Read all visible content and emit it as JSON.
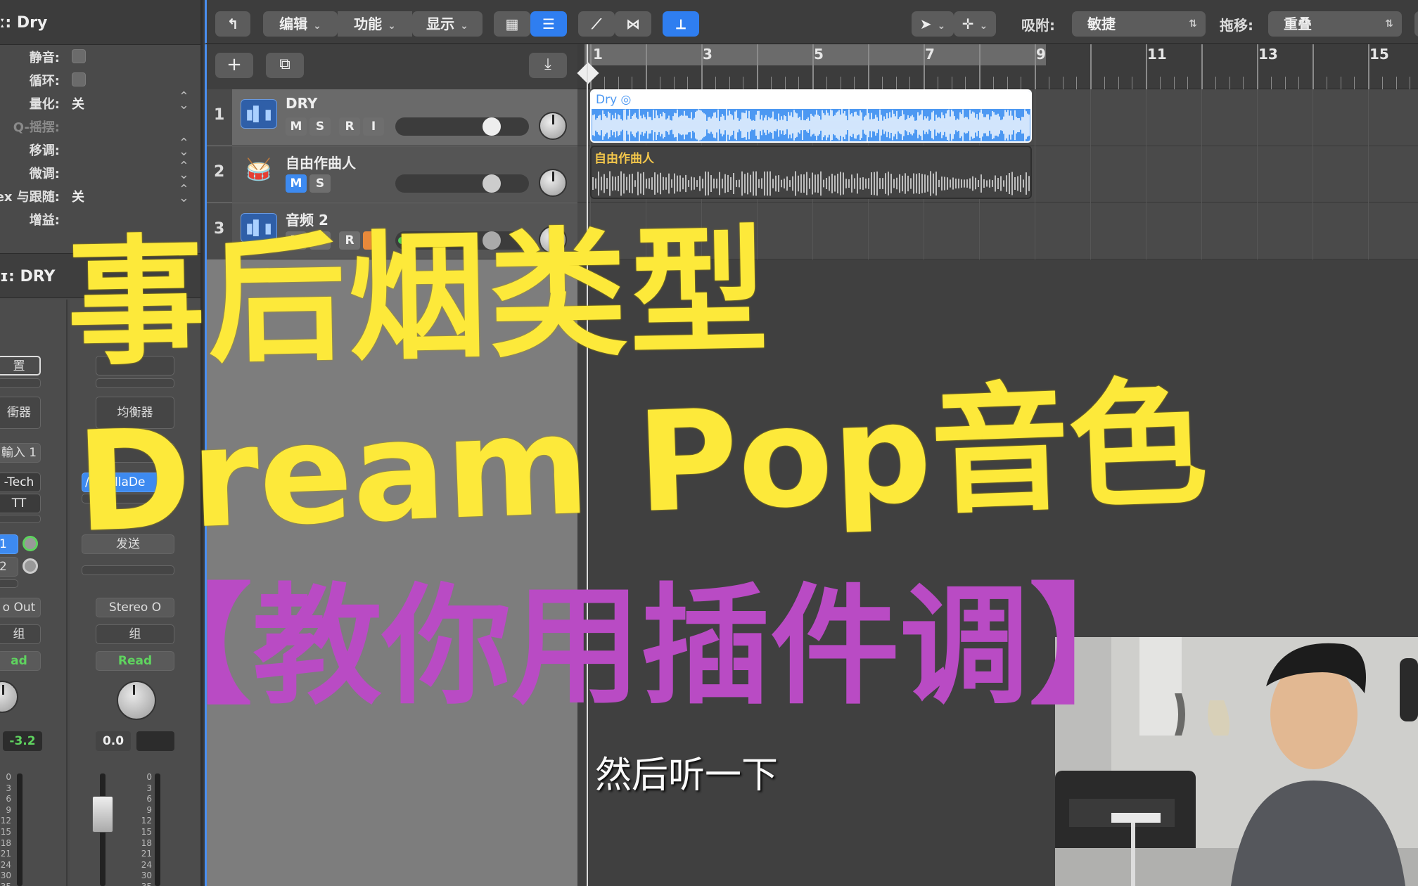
{
  "inspector": {
    "region_name": "ː: Dry",
    "rows": [
      {
        "label": "静音:",
        "type": "checkbox"
      },
      {
        "label": "循环:",
        "type": "checkbox"
      },
      {
        "label": "量化:",
        "value": "关",
        "type": "select"
      },
      {
        "label": "Q-摇摆:",
        "type": "dim"
      },
      {
        "label": "移调:",
        "type": "select"
      },
      {
        "label": "微调:",
        "type": "select"
      },
      {
        "label": "ex 与跟随:",
        "value": "关",
        "type": "select"
      },
      {
        "label": "增益:",
        "type": "plain"
      }
    ],
    "track_name": "ɪ: DRY",
    "strip_a": {
      "setting": "置",
      "eq": "衝器",
      "input": "輸入 1",
      "plugin1": "-Tech",
      "plugin2": "TT",
      "send1": "1",
      "send2": "2",
      "output": "o Out",
      "group": "组",
      "automation": "ad",
      "volume": "-3.2",
      "scale": [
        "0",
        "3",
        "6",
        "9",
        "12",
        "15",
        "18",
        "21",
        "24",
        "30",
        "35"
      ]
    },
    "strip_b": {
      "eq": "均衡器",
      "plugin1": "/alhallaDe",
      "sends": "发送",
      "output": "Stereo O",
      "group": "组",
      "automation": "Read",
      "volume": "0.0",
      "scale": [
        "0",
        "3",
        "6",
        "9",
        "12",
        "15",
        "18",
        "21",
        "24",
        "30",
        "35"
      ]
    }
  },
  "controlbar": {
    "back_icon": "back-arrow-icon",
    "edit": "编辑",
    "functions": "功能",
    "view": "显示",
    "snap_label": "吸附:",
    "snap_value": "敏捷",
    "drag_label": "拖移:",
    "drag_value": "重叠"
  },
  "tracks": [
    {
      "number": "1",
      "name": "DRY",
      "buttons": [
        "M",
        "S",
        "R",
        "I"
      ]
    },
    {
      "number": "2",
      "name": "自由作曲人",
      "buttons": [
        "M",
        "S"
      ]
    },
    {
      "number": "3",
      "name": "音频 2",
      "buttons": [
        "M",
        "S",
        "R",
        "I"
      ]
    }
  ],
  "ruler": {
    "bars": [
      "1",
      "3",
      "5",
      "7",
      "9",
      "11",
      "13",
      "15"
    ]
  },
  "regions": {
    "dry": "Dry",
    "drum": "自由作曲人"
  },
  "overlay": {
    "line1": "事后烟类型",
    "line2": "Dream Pop音色",
    "line3": "【教你用插件调】",
    "subtitle": "然后听一下"
  }
}
